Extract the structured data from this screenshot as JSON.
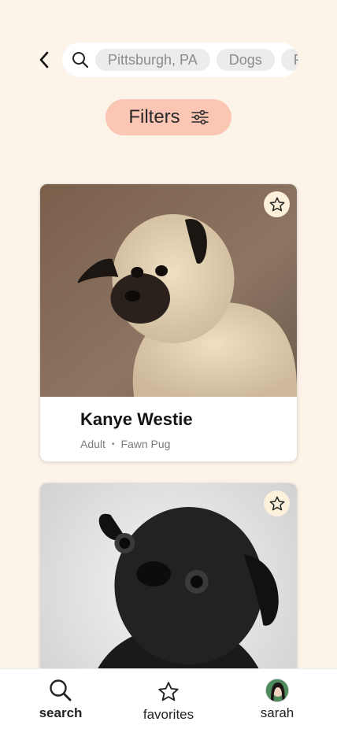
{
  "search": {
    "chips": [
      "Pittsburgh, PA",
      "Dogs",
      "Pug"
    ]
  },
  "filters": {
    "label": "Filters"
  },
  "pets": [
    {
      "name": "Kanye Westie",
      "age": "Adult",
      "breed": "Fawn Pug"
    },
    {
      "name": "",
      "age": "",
      "breed": ""
    }
  ],
  "nav": {
    "search": "search",
    "favorites": "favorites",
    "profile": "sarah"
  },
  "colors": {
    "background": "#fdf4e9",
    "accent": "#fbc6b4",
    "chip": "#ececec"
  }
}
